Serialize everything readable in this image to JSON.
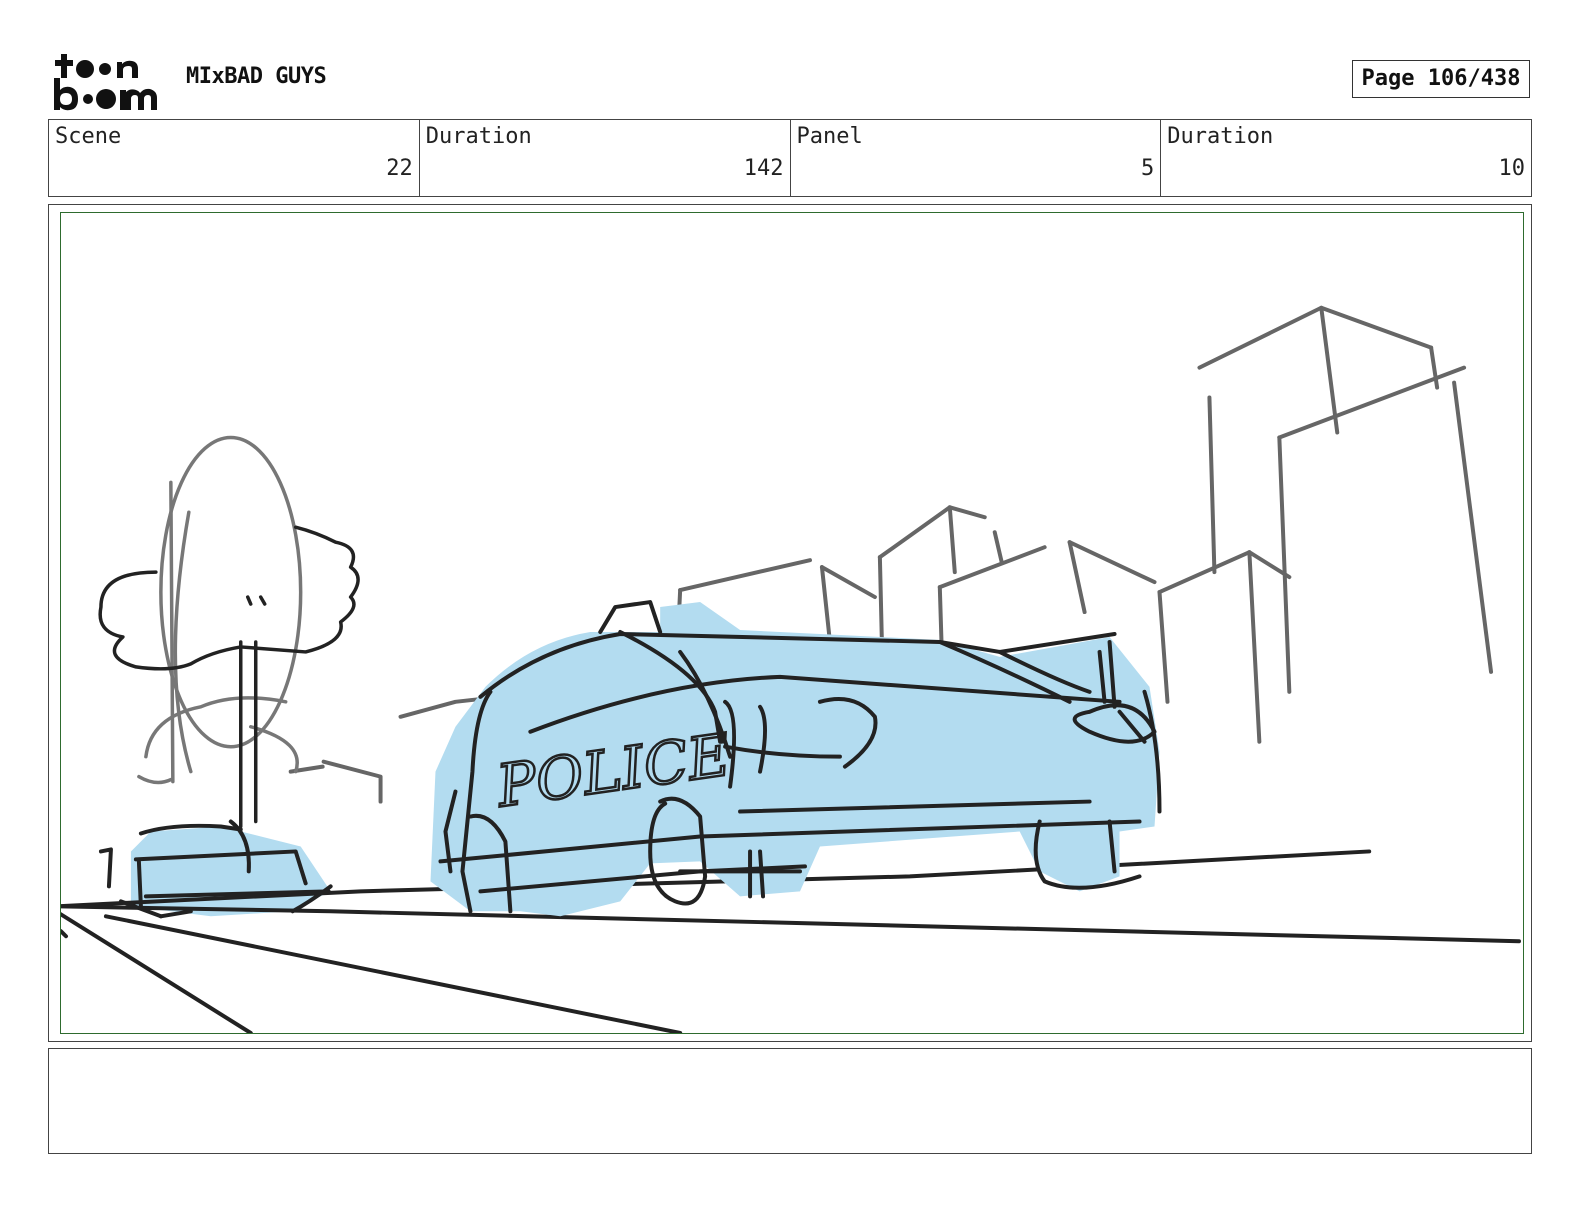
{
  "header": {
    "logo_text": "toon boom",
    "project_title": "MIxBAD GUYS",
    "page_label": "Page 106/438"
  },
  "info": {
    "scene_label": "Scene",
    "scene_value": "22",
    "scene_duration_label": "Duration",
    "scene_duration_value": "142",
    "panel_label": "Panel",
    "panel_value": "5",
    "panel_duration_label": "Duration",
    "panel_duration_value": "10"
  },
  "panel": {
    "car_text": "POLICE",
    "fill_color": "#b3dcf0",
    "frame_color": "#2e6b2e"
  },
  "notes": {
    "text": ""
  }
}
